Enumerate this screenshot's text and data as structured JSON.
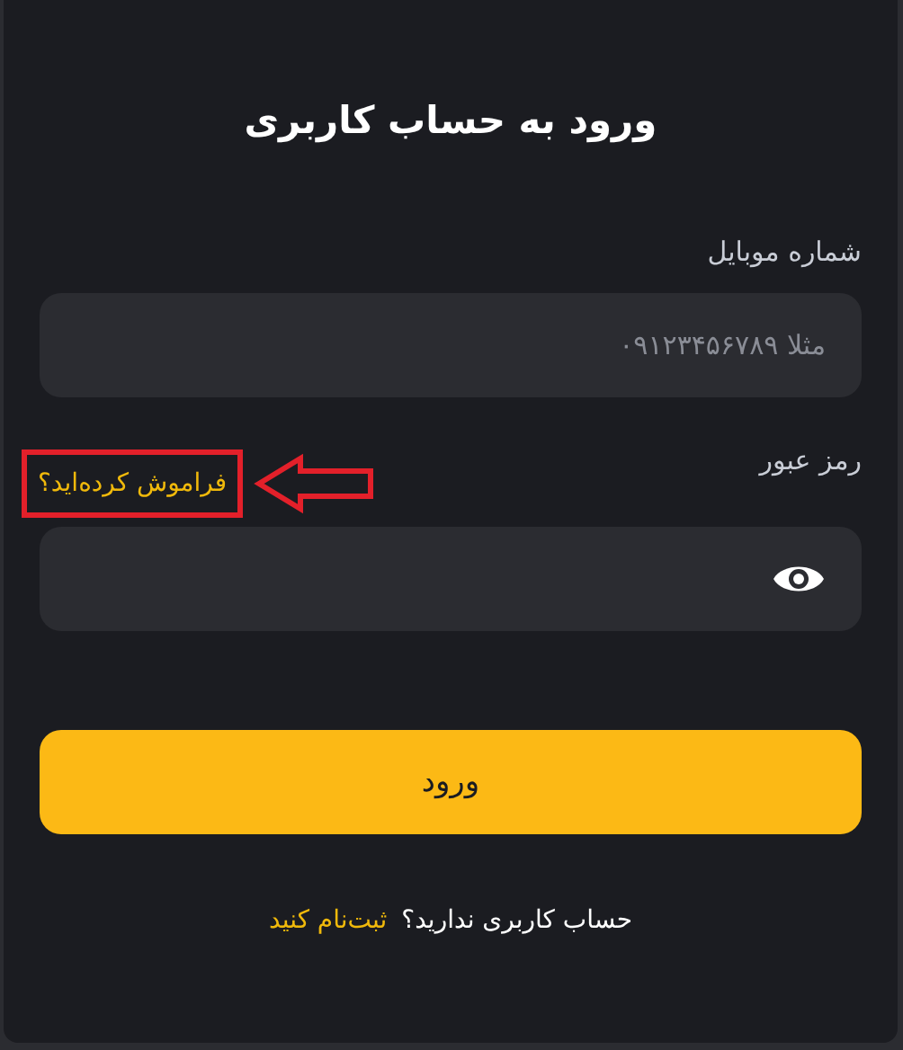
{
  "title": "ورود به حساب کاربری",
  "mobile": {
    "label": "شماره موبایل",
    "placeholder": "مثلا ۰۹۱۲۳۴۵۶۷۸۹"
  },
  "password": {
    "label": "رمز عبور",
    "forgot_link": "فراموش کرده‌اید؟",
    "forgot_highlighted": true
  },
  "submit_button": "ورود",
  "footer": {
    "text": "حساب کاربری ندارید؟",
    "link": "ثبت‌نام کنید"
  }
}
